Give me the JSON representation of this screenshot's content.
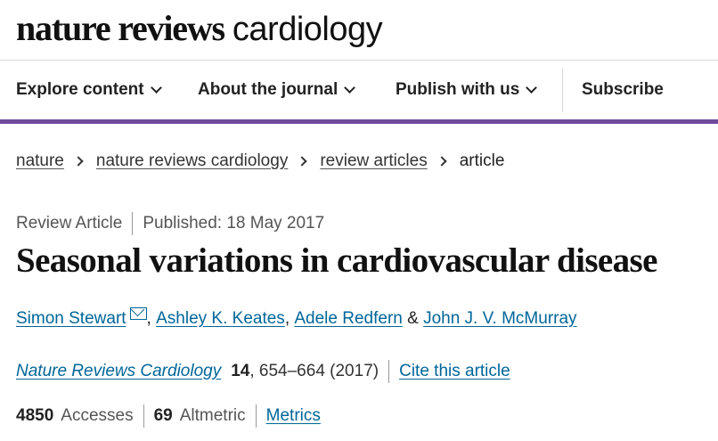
{
  "masthead": {
    "bold": "nature reviews",
    "light": "cardiology"
  },
  "nav": {
    "items": [
      {
        "label": "Explore content"
      },
      {
        "label": "About the journal"
      },
      {
        "label": "Publish with us"
      }
    ],
    "subscribe": "Subscribe"
  },
  "breadcrumb": {
    "items": [
      "nature",
      "nature reviews cardiology",
      "review articles"
    ],
    "current": "article"
  },
  "article": {
    "type": "Review Article",
    "published": "Published: 18 May 2017",
    "title": "Seasonal variations in cardiovascular disease",
    "authors": [
      "Simon Stewart",
      "Ashley K. Keates",
      "Adele Redfern",
      "John J. V. McMurray"
    ],
    "author_separators": [
      ", ",
      ", ",
      " & "
    ],
    "journal": "Nature Reviews Cardiology",
    "volume": "14",
    "pages_year": ", 654–664 (2017)",
    "cite_label": "Cite this article"
  },
  "metrics": {
    "accesses_count": "4850",
    "accesses_label": "Accesses",
    "altmetric_count": "69",
    "altmetric_label": "Altmetric",
    "metrics_link": "Metrics"
  },
  "icons": {
    "author_contact": "mail-icon",
    "dropdown": "chevron-down-icon",
    "breadcrumb_separator": "chevron-right-icon"
  },
  "colors": {
    "accent_rule": "#6f4a9c",
    "link": "#006699"
  }
}
